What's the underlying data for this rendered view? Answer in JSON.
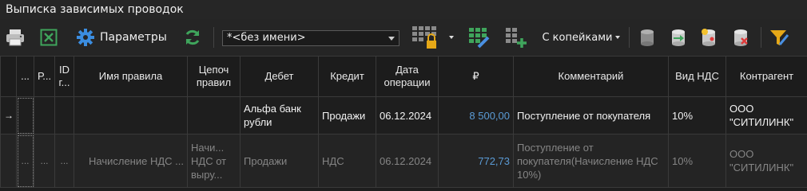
{
  "window": {
    "title": "Выписка зависимых проводок"
  },
  "toolbar": {
    "params_label": "Параметры",
    "name_combo_value": "*<без имени>",
    "kopeks_label": "С копейками",
    "icons": [
      "print-icon",
      "excel-icon",
      "gear-icon",
      "refresh-icon",
      "grid-lock-icon",
      "grid-edit-icon",
      "grid-add-icon",
      "db-icon",
      "db-sync-icon",
      "db-new-icon",
      "db-delete-icon",
      "filter-icon"
    ]
  },
  "table": {
    "columns": [
      "...",
      "Р...",
      "ID г...",
      "Имя правила",
      "Цепоч правил",
      "Дебет",
      "Кредит",
      "Дата операции",
      "₽",
      "Комментарий",
      "Вид НДС",
      "Контрагент"
    ],
    "rows": [
      {
        "indicator": "→",
        "c1": "",
        "c2": "",
        "c3": "",
        "rule_name": "",
        "chain": "",
        "debit": "Альфа банк рубли",
        "credit": "Продажи",
        "date": "06.12.2024",
        "amount": "8 500,00",
        "comment": "Поступление от покупателя",
        "vat": "10%",
        "counterparty": "ООО \"СИТИЛИНК\""
      },
      {
        "indicator": "",
        "c1": "...",
        "c2": "...",
        "c3": "...",
        "rule_name": "Начисление НДС ...",
        "chain": "Начи... НДС от выру...",
        "debit": "Продажи",
        "credit": "НДС",
        "date": "06.12.2024",
        "amount": "772,73",
        "comment": "Поступление от покупателя(Начисление НДС 10%)",
        "vat": "10%",
        "counterparty": "ООО \"СИТИЛИНК\""
      }
    ]
  },
  "colors": {
    "accent": "#5b9bd5",
    "background": "#1e1e1e",
    "header": "#1c1c1c"
  }
}
